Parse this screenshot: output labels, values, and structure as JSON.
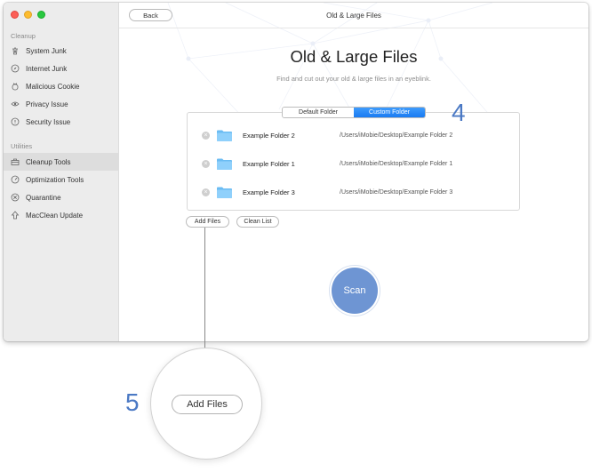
{
  "window": {
    "title": "Old & Large Files",
    "back_label": "Back"
  },
  "sidebar": {
    "sections": [
      {
        "label": "Cleanup",
        "items": [
          {
            "label": "System Junk",
            "icon": "trash-icon"
          },
          {
            "label": "Internet Junk",
            "icon": "compass-icon"
          },
          {
            "label": "Malicious Cookie",
            "icon": "cookie-icon"
          },
          {
            "label": "Privacy Issue",
            "icon": "eye-icon"
          },
          {
            "label": "Security Issue",
            "icon": "shield-icon"
          }
        ]
      },
      {
        "label": "Utilities",
        "items": [
          {
            "label": "Cleanup Tools",
            "icon": "toolbox-icon",
            "active": true
          },
          {
            "label": "Optimization Tools",
            "icon": "gauge-icon"
          },
          {
            "label": "Quarantine",
            "icon": "quarantine-icon"
          },
          {
            "label": "MacClean Update",
            "icon": "update-arrow-icon"
          }
        ]
      }
    ]
  },
  "main": {
    "heading": "Old & Large Files",
    "subtitle": "Find and cut out your old & large files in an eyeblink.",
    "tabs": [
      {
        "label": "Default Folder",
        "selected": false
      },
      {
        "label": "Custom Folder",
        "selected": true
      }
    ],
    "folders": [
      {
        "name": "Example Folder 2",
        "path": "/Users/iMobie/Desktop/Example Folder 2"
      },
      {
        "name": "Example Folder 1",
        "path": "/Users/iMobie/Desktop/Example Folder 1"
      },
      {
        "name": "Example Folder 3",
        "path": "/Users/iMobie/Desktop/Example Folder 3"
      }
    ],
    "add_files_label": "Add Files",
    "clean_list_label": "Clean List",
    "scan_label": "Scan"
  },
  "callouts": {
    "step4": "4",
    "step5": "5",
    "magnified_label": "Add Files"
  },
  "colors": {
    "accent": "#1a7bf1",
    "scan": "#6e95d3",
    "callout": "#4b79c4"
  }
}
